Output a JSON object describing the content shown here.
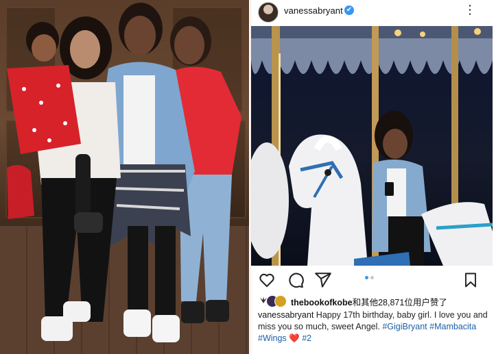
{
  "post": {
    "username": "vanessabryant",
    "verified_mark": "✔",
    "more_glyph": "⋮",
    "likes": {
      "liker": "thebookofkobe",
      "suffix": "和其他28,871位用户赞了"
    },
    "caption": {
      "username": "vanessabryant",
      "text": " Happy 17th birthday, baby girl. I love you and miss you so much, sweet Angel.",
      "tag1": "#GigiBryant",
      "tag2": "#Mambacita",
      "tag3": "#Wings",
      "heart": "❤️",
      "tag4": "#2"
    },
    "carousel": {
      "count": 2,
      "active_index": 1
    }
  },
  "icons": {
    "like": "heart-outline-icon",
    "comment": "comment-icon",
    "share": "share-icon",
    "save": "bookmark-icon",
    "more": "more-vertical-icon",
    "verified": "verified-badge-icon"
  },
  "colors": {
    "link": "#1a5ea8",
    "verified": "#3897f0",
    "heart": "#e0245e"
  }
}
